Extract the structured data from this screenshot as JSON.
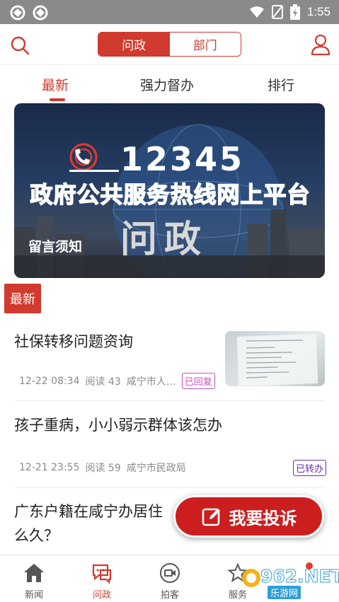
{
  "statusbar": {
    "time": "1:55"
  },
  "header": {
    "segments": [
      "问政",
      "部门"
    ],
    "active_segment": "问政"
  },
  "subtabs": [
    {
      "label": "最新",
      "active": true
    },
    {
      "label": "强力督办",
      "active": false
    },
    {
      "label": "排行",
      "active": false
    }
  ],
  "banner": {
    "hotline": "12345",
    "title": "政府公共服务热线网上平台",
    "subtitle": "问政",
    "caption": "留言须知"
  },
  "section_tag": "最新",
  "news": [
    {
      "title": "社保转移问题资询",
      "date": "12-22 08:34",
      "reads": "阅读 43",
      "dept": "咸宁市人…",
      "status": "已回复",
      "has_thumb": true
    },
    {
      "title": "孩子重病，小小弱示群体该怎办",
      "date": "12-21 23:55",
      "reads": "阅读 59",
      "dept": "咸宁市民政局",
      "status": "已转办",
      "has_thumb": false
    },
    {
      "title_line1": "广东户籍在咸宁办居住",
      "title_line2": "么久？"
    }
  ],
  "fab": {
    "label": "我要投诉"
  },
  "bottom_nav": [
    {
      "label": "新闻",
      "icon": "home-icon",
      "active": false
    },
    {
      "label": "问政",
      "icon": "chat-icon",
      "active": true
    },
    {
      "label": "拍客",
      "icon": "video-icon",
      "active": false
    },
    {
      "label": "服务",
      "icon": "star-icon",
      "active": false
    }
  ],
  "watermark": {
    "text": "962.NET",
    "sub": "乐游网"
  },
  "colors": {
    "accent": "#d13a2e",
    "fab": "#cc1e1e",
    "badge_replied": "#c44ec0",
    "badge_forwarded": "#6b2fa5"
  }
}
